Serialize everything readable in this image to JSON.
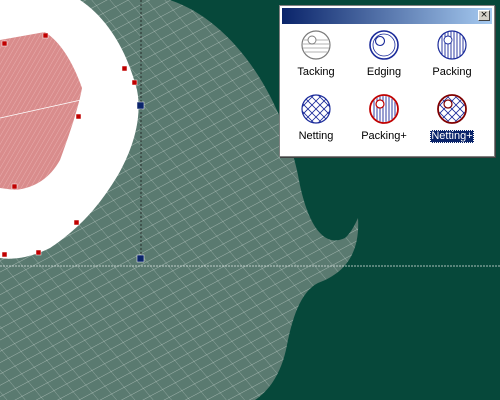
{
  "colors": {
    "background": "#06483a",
    "fill_area": "#5a7a70",
    "stitch_line": "#e6ecea",
    "pink_region": "#d98c8c",
    "node_red": "#c00000",
    "node_blue": "#0a246a",
    "selection": "#0a246a"
  },
  "palette": {
    "close_glyph": "×",
    "tools": [
      {
        "label": "Tacking",
        "icon": "tacking-icon",
        "selected": false
      },
      {
        "label": "Edging",
        "icon": "edging-icon",
        "selected": false
      },
      {
        "label": "Packing",
        "icon": "packing-icon",
        "selected": false
      },
      {
        "label": "Netting",
        "icon": "netting-icon",
        "selected": false
      },
      {
        "label": "Packing+",
        "icon": "packing-plus-icon",
        "selected": false
      },
      {
        "label": "Netting+",
        "icon": "netting-plus-icon",
        "selected": true
      }
    ]
  }
}
